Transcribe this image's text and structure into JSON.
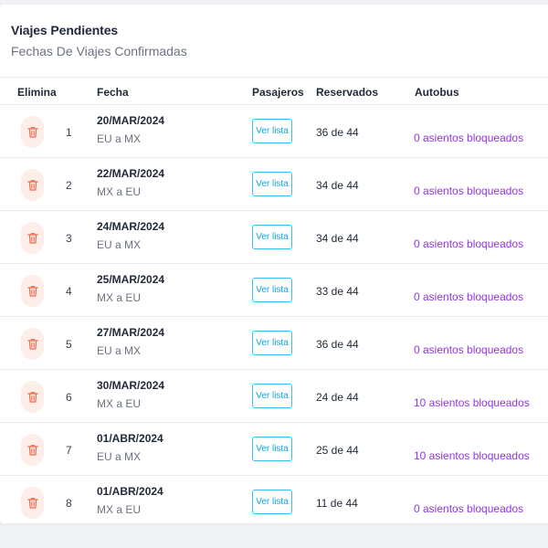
{
  "header": {
    "title": "Viajes Pendientes",
    "subtitle": "Fechas De Viajes Confirmadas"
  },
  "table": {
    "columns": [
      "Elimina",
      "Fecha",
      "Pasajeros",
      "Reservados",
      "Autobus"
    ],
    "rows": [
      {
        "index": "1",
        "date": "20/MAR/2024",
        "route": "EU a MX",
        "pasajeros_label": "Ver lista",
        "reservados": "36 de 44",
        "autobus": "0 asientos bloqueados"
      },
      {
        "index": "2",
        "date": "22/MAR/2024",
        "route": "MX a EU",
        "pasajeros_label": "Ver lista",
        "reservados": "34 de 44",
        "autobus": "0 asientos bloqueados"
      },
      {
        "index": "3",
        "date": "24/MAR/2024",
        "route": "EU a MX",
        "pasajeros_label": "Ver lista",
        "reservados": "34 de 44",
        "autobus": "0 asientos bloqueados"
      },
      {
        "index": "4",
        "date": "25/MAR/2024",
        "route": "MX a EU",
        "pasajeros_label": "Ver lista",
        "reservados": "33 de 44",
        "autobus": "0 asientos bloqueados"
      },
      {
        "index": "5",
        "date": "27/MAR/2024",
        "route": "EU a MX",
        "pasajeros_label": "Ver lista",
        "reservados": "36 de 44",
        "autobus": "0 asientos bloqueados"
      },
      {
        "index": "6",
        "date": "30/MAR/2024",
        "route": "MX a EU",
        "pasajeros_label": "Ver lista",
        "reservados": "24 de 44",
        "autobus": "10 asientos bloqueados"
      },
      {
        "index": "7",
        "date": "01/ABR/2024",
        "route": "EU a MX",
        "pasajeros_label": "Ver lista",
        "reservados": "25 de 44",
        "autobus": "10 asientos bloqueados"
      },
      {
        "index": "8",
        "date": "01/ABR/2024",
        "route": "MX a EU",
        "pasajeros_label": "Ver lista",
        "reservados": "11 de 44",
        "autobus": "0 asientos bloqueados"
      }
    ]
  },
  "icons": {
    "delete": "trash-icon"
  },
  "colors": {
    "delete_icon": "#ef6a4c",
    "delete_bg": "#fdeee9",
    "link_button": "#0ea5e9",
    "autobus_text": "#9333ea"
  }
}
